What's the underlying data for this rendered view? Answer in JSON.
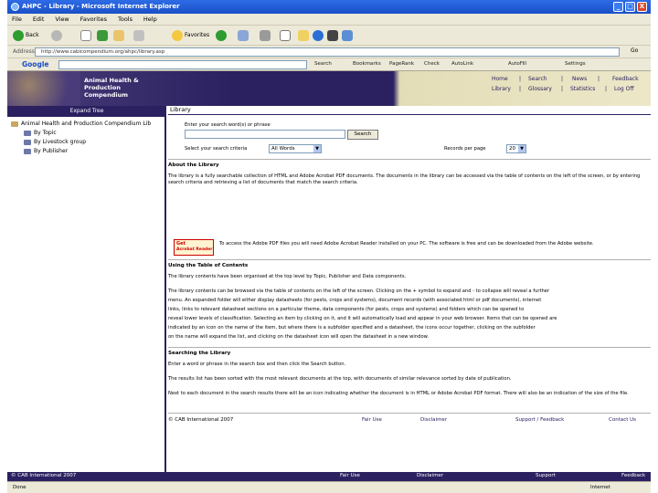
{
  "window": {
    "title": "AHPC - Library - Microsoft Internet Explorer",
    "minimize": "_",
    "maximize": "□",
    "close": "X"
  },
  "menu": [
    "File",
    "Edit",
    "View",
    "Favorites",
    "Tools",
    "Help"
  ],
  "toolbar": {
    "back": "Back",
    "favorites": "Favorites"
  },
  "address": {
    "label": "Address",
    "url": "http://www.cabicompendium.org/ahpc/library.asp",
    "go": "Go"
  },
  "googlebar": {
    "logo": "Google",
    "search": "Search",
    "bookmarks": "Bookmarks",
    "pagerank": "PageRank",
    "check": "Check",
    "autolink": "AutoLink",
    "autofill": "AutoFill",
    "settings": "Settings"
  },
  "site": {
    "title_lines": [
      "Animal Health &",
      "Production",
      "Compendium"
    ],
    "nav": {
      "home": "Home",
      "search": "Search",
      "news": "News",
      "feedback": "Feedback",
      "library": "Library",
      "glossary": "Glossary",
      "statistics": "Statistics",
      "logout": "Log Off"
    }
  },
  "tree": {
    "expand": "Expand Tree",
    "root": "Animal Health and Production Compendium Lib",
    "items": [
      "By Topic",
      "By Livestock group",
      "By Publisher"
    ]
  },
  "library": {
    "heading": "Library",
    "search_prompt": "Enter your search word(s) or phrase",
    "search_button": "Search",
    "section_label": "Select your search criteria",
    "section_value": "All Words",
    "records_label": "Records per page",
    "records_value": "20",
    "about_heading": "About the Library",
    "about_text": "The library is a fully searchable collection of HTML and Adobe Acrobat PDF documents. The documents in the library can be accessed via the table of contents on the left of the screen, or by entering search criteria and retrieving a list of documents that match the search criteria.",
    "acrobat_line1": "Get",
    "acrobat_line2": "Acrobat Reader",
    "acrobat_text": "To access the Adobe PDF files you will need Adobe Acrobat Reader installed on your PC. The software is free and can be downloaded from the Adobe website.",
    "toc_heading": "Using the Table of Contents",
    "toc_text": "The library contents have been organised at the top level by Topic, Publisher and Data components.",
    "toc_para": [
      "The library contents can be browsed via the table of contents on the left of the screen. Clicking on the + symbol to expand and - to collapse will reveal a further",
      "menu. An expanded folder will either display datasheets (for pests, crops and systems), document records (with associated html or pdf documents), internet",
      "links, links to relevant datasheet sections on a particular theme, data components (for pests, crops and systems) and folders which can be opened to",
      "reveal lower levels of classification. Selecting an item by clicking on it, and it will automatically load and appear in your web browser. Items that can be opened are",
      "indicated by an icon on the name of the item, but where there is a subfolder specified and a datasheet, the icons occur together, clicking on the subfolder",
      "on the name will expand the list, and clicking on the datasheet icon will open the datasheet in a new window."
    ],
    "search_heading": "Searching the Library",
    "search_help": "Enter a word or phrase in the search box and then click the Search button.",
    "search_help2": "The results list has been sorted with the most relevant documents at the top, with documents of similar relevance sorted by date of publication.",
    "search_help3": "Next to each document in the search results there will be an icon indicating whether the document is in HTML or Adobe Acrobat PDF format. There will also be an indication of the size of the file.",
    "copyright": "© CAB International 2007",
    "fair_use": "Fair Use",
    "disclaimer": "Disclaimer",
    "support": "Support / Feedback",
    "contact": "Contact Us"
  },
  "pagefooter": {
    "copyright": "© CAB International 2007",
    "fair_use": "Fair Use",
    "disclaimer": "Disclaimer",
    "support": "Support",
    "feedback": "Feedback"
  },
  "status": {
    "left": "Done",
    "zone": "Internet"
  }
}
